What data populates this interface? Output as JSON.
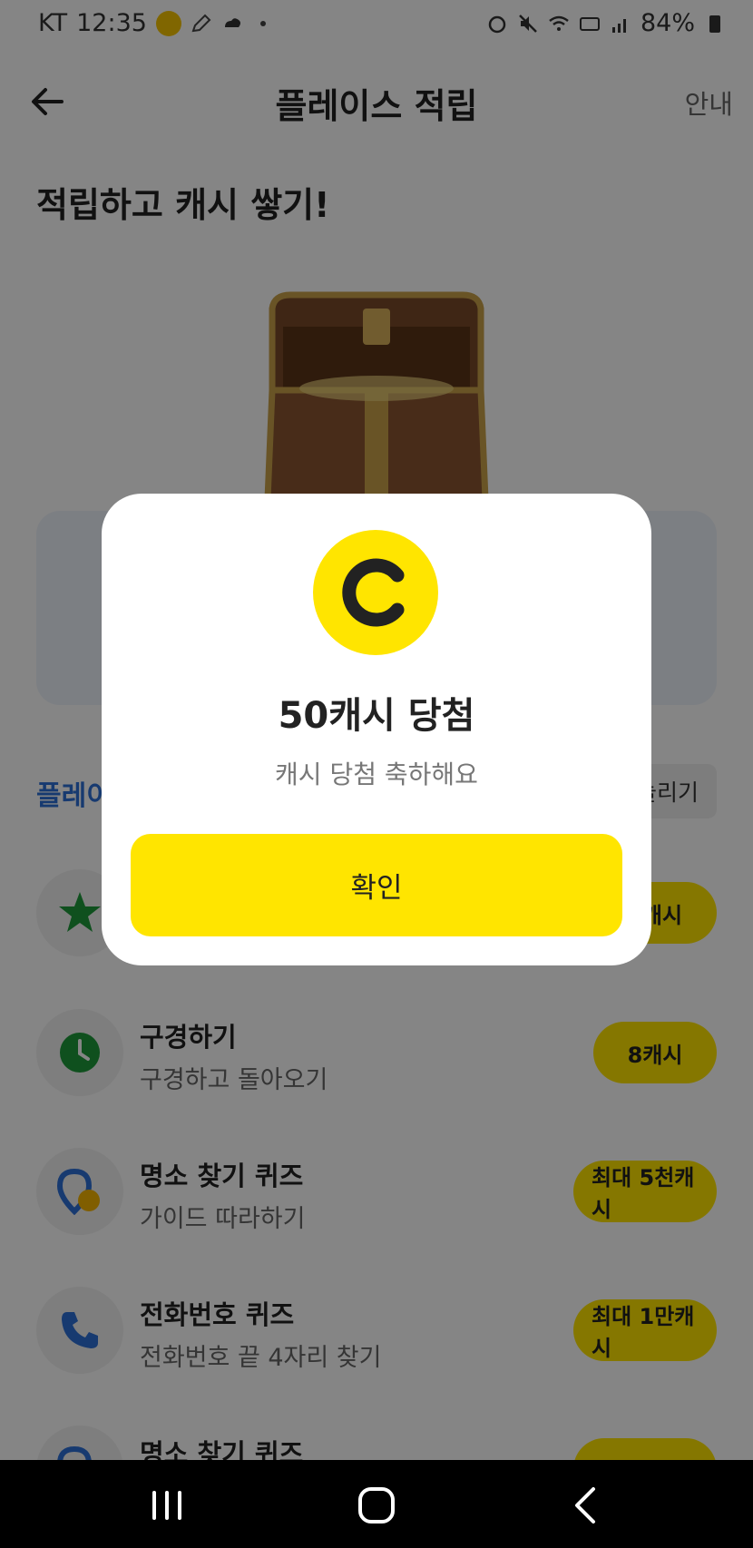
{
  "status_bar": {
    "carrier": "KT",
    "time": "12:35",
    "battery": "84%"
  },
  "header": {
    "title": "플레이스 적립",
    "guide_label": "안내"
  },
  "headline": "적립하고 캐시 쌓기!",
  "section": {
    "label": "플레이",
    "chip_label": "늘리기"
  },
  "tasks": [
    {
      "title": "",
      "subtitle": "",
      "reward": "캐시",
      "icon": "star-icon"
    },
    {
      "title": "구경하기",
      "subtitle": "구경하고 돌아오기",
      "reward": "8캐시",
      "icon": "clock-icon"
    },
    {
      "title": "명소 찾기 퀴즈",
      "subtitle": "가이드 따라하기",
      "reward": "최대 5천캐시",
      "icon": "map-pin-icon"
    },
    {
      "title": "전화번호 퀴즈",
      "subtitle": "전화번호 끝 4자리 찾기",
      "reward": "최대 1만캐시",
      "icon": "phone-icon"
    },
    {
      "title": "명소 찾기 퀴즈",
      "subtitle": "",
      "reward": "",
      "icon": "map-pin-icon"
    }
  ],
  "modal": {
    "title": "50캐시 당첨",
    "subtitle": "캐시 당첨 축하해요",
    "confirm_label": "확인"
  },
  "colors": {
    "accent_yellow": "#ffe500",
    "link_blue": "#2d6fd6",
    "overlay": "rgba(0,0,0,0.48)"
  }
}
